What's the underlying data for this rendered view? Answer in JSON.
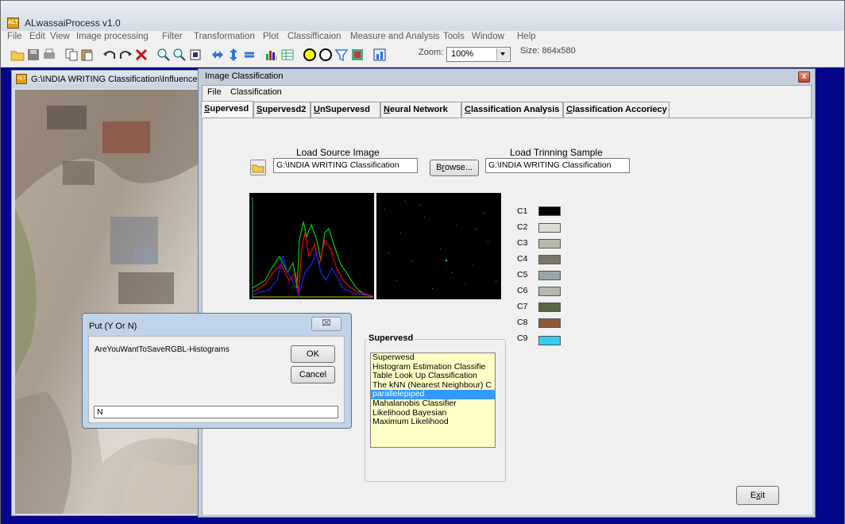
{
  "app": {
    "title": "ALwassaiProcess v1.0",
    "icon_text": "ALT",
    "menu": [
      "File",
      "Edit",
      "View",
      "Image processing",
      "Filter",
      "Transformation",
      "Plot",
      "Classifficaion",
      "Measure and Analysis",
      "Tools",
      "Window",
      "Help"
    ],
    "toolbar": {
      "icons": [
        "open-folder-icon",
        "save-icon",
        "print-icon",
        "copy-icon",
        "paste-icon",
        "undo-icon",
        "redo-icon",
        "delete-icon",
        "zoom-in-icon",
        "zoom-out-icon",
        "crop-icon",
        "swap-icon",
        "flip-vertical-icon",
        "rotate-icon",
        "histogram-icon",
        "table-icon",
        "circle-icon",
        "ring-icon",
        "filter-icon",
        "layers-icon",
        "chart-icon"
      ],
      "zoom_label": "Zoom:",
      "zoom_value": "100%",
      "size_label": "Size: 864x580"
    },
    "workspace_color": "#06068a"
  },
  "image_window": {
    "title": "G:\\INDIA WRITING Classification\\Influences"
  },
  "classification_window": {
    "title": "Image Classification",
    "close_glyph": "x",
    "menu": [
      "File",
      "Classification"
    ],
    "tabs": [
      "Supervesd",
      "Supervesd2",
      "UnSupervesd",
      "Neural Network",
      "Classification Analysis",
      "Classification Accoriecy"
    ],
    "active_tab": "Supervesd",
    "load_source_label": "Load Source Image",
    "source_path": "G:\\INDIA WRITING Classification",
    "browse_button": "Browse...",
    "load_training_label": "Load Trinning Sample",
    "training_path": "G:\\INDIA WRITING Classification",
    "classes": [
      {
        "label": "C1",
        "color": "#000000"
      },
      {
        "label": "C2",
        "color": "#dcdcd0"
      },
      {
        "label": "C3",
        "color": "#b5b9a8"
      },
      {
        "label": "C4",
        "color": "#7a776a"
      },
      {
        "label": "C5",
        "color": "#96a4ad"
      },
      {
        "label": "C6",
        "color": "#b3b8b1"
      },
      {
        "label": "C7",
        "color": "#596744"
      },
      {
        "label": "C8",
        "color": "#8a5a37"
      },
      {
        "label": "C9",
        "color": "#33cdf0"
      }
    ],
    "method_group": {
      "title": "Supervesd",
      "items": [
        "Superwesd",
        "Histogram Estimation Classifie",
        "Table Look Up Classification",
        "The kNN (Nearest Neighbour) C",
        "parallelepiped",
        "Mahalanobis Classifier",
        "Likelihood Bayesian",
        "Maximum Likelihood"
      ],
      "selected": "parallelepiped"
    },
    "exit_button": "Exit"
  },
  "dialog": {
    "title": "Put (Y Or N)",
    "close_glyph": "⌧",
    "message": "AreYouWantToSaveRGBL-Histograms",
    "ok": "OK",
    "cancel": "Cancel",
    "answer": "N"
  }
}
